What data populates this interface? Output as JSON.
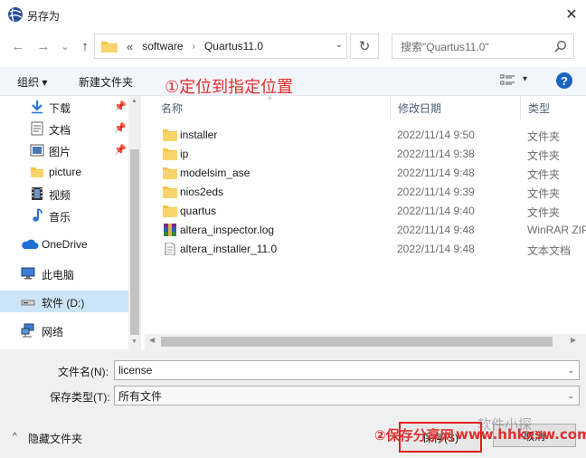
{
  "window": {
    "title": "另存为",
    "close_glyph": "✕",
    "app_icon": "globe-app-icon"
  },
  "address": {
    "back_glyph": "←",
    "forward_glyph": "→",
    "recent_glyph": "⌄",
    "up_glyph": "↑",
    "overflow": "«",
    "crumbs": [
      "software",
      "Quartus11.0"
    ],
    "separator": "›",
    "dropdown_glyph": "⌄",
    "refresh_glyph": "↻",
    "search_placeholder": "搜索\"Quartus11.0\""
  },
  "toolbar": {
    "organize": "组织 ▾",
    "new_folder": "新建文件夹",
    "annotation": "①定位到指定位置",
    "view_dropdown": "▾",
    "help": "?"
  },
  "nav": {
    "items": [
      {
        "label": "下载",
        "icon": "download-arrow-icon",
        "pinned": true
      },
      {
        "label": "文档",
        "icon": "document-icon",
        "pinned": true
      },
      {
        "label": "图片",
        "icon": "picture-icon",
        "pinned": true
      },
      {
        "label": "picture",
        "icon": "folder-icon",
        "pinned": false
      },
      {
        "label": "视频",
        "icon": "video-icon",
        "pinned": false
      },
      {
        "label": "音乐",
        "icon": "music-note-icon",
        "pinned": false
      },
      {
        "label": "OneDrive",
        "icon": "cloud-icon",
        "pinned": false
      },
      {
        "label": "此电脑",
        "icon": "computer-icon",
        "pinned": false
      },
      {
        "label": "软件 (D:)",
        "icon": "drive-icon",
        "pinned": false,
        "selected": true
      },
      {
        "label": "网络",
        "icon": "network-icon",
        "pinned": false
      }
    ],
    "pin_glyph": "📌"
  },
  "columns": {
    "name": "名称",
    "modified": "修改日期",
    "type": "类型",
    "sort_glyph": "^"
  },
  "files": [
    {
      "name": "installer",
      "date": "2022/11/14 9:50",
      "type": "文件夹",
      "icon": "folder-icon"
    },
    {
      "name": "ip",
      "date": "2022/11/14 9:38",
      "type": "文件夹",
      "icon": "folder-icon"
    },
    {
      "name": "modelsim_ase",
      "date": "2022/11/14 9:48",
      "type": "文件夹",
      "icon": "folder-icon"
    },
    {
      "name": "nios2eds",
      "date": "2022/11/14 9:39",
      "type": "文件夹",
      "icon": "folder-icon"
    },
    {
      "name": "quartus",
      "date": "2022/11/14 9:40",
      "type": "文件夹",
      "icon": "folder-icon"
    },
    {
      "name": "altera_inspector.log",
      "date": "2022/11/14 9:48",
      "type": "WinRAR ZIP",
      "icon": "winrar-archive-icon"
    },
    {
      "name": "altera_installer_11.0",
      "date": "2022/11/14 9:48",
      "type": "文本文档",
      "icon": "text-file-icon"
    }
  ],
  "form": {
    "filename_label": "文件名(N):",
    "filename_value": "license",
    "filetype_label": "保存类型(T):",
    "filetype_value": "所有文件",
    "dropdown_glyph": "⌄"
  },
  "footer": {
    "hide_folders": "隐藏文件夹",
    "hide_chevron": "^",
    "save": "保存(S)",
    "cancel": "取消",
    "watermark_left": "②保存分享网",
    "watermark_right": "www.hhkxsw.com",
    "watermark_faint": "软件小探"
  },
  "colors": {
    "accent": "#1a62c2",
    "annotation": "#e52a2a",
    "selected": "#cce4f7",
    "folder": "#f5c542"
  }
}
